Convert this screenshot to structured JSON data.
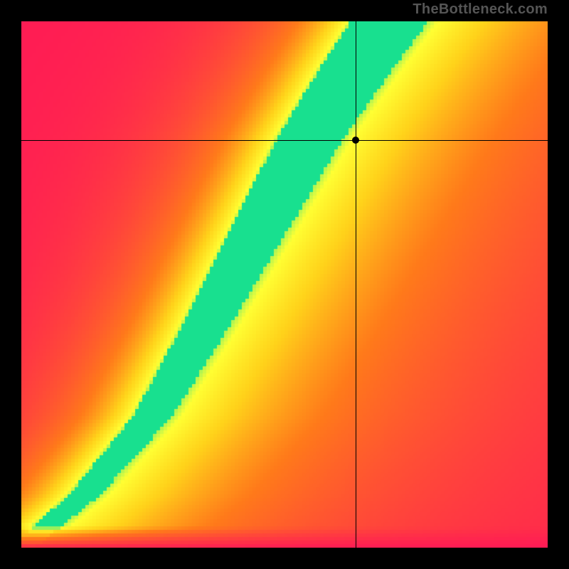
{
  "watermark": "TheBottleneck.com",
  "chart_data": {
    "type": "heatmap",
    "title": "",
    "xlabel": "",
    "ylabel": "",
    "xlim": [
      0,
      1
    ],
    "ylim": [
      0,
      1
    ],
    "crosshair": {
      "x": 0.635,
      "y": 0.775
    },
    "marker": {
      "x": 0.635,
      "y": 0.775
    },
    "colorscale": [
      {
        "stop": 0.0,
        "color": "#ff1a55"
      },
      {
        "stop": 0.45,
        "color": "#ff7a1a"
      },
      {
        "stop": 0.7,
        "color": "#ffd21a"
      },
      {
        "stop": 0.88,
        "color": "#ffff33"
      },
      {
        "stop": 1.0,
        "color": "#18e08f"
      }
    ],
    "ridge": {
      "description": "Narrow high-value S-curved ridge from bottom-left corner to top center, flanked by smooth falloff to low values on both sides.",
      "control_points_xy": [
        [
          0.0,
          0.0
        ],
        [
          0.12,
          0.1
        ],
        [
          0.25,
          0.25
        ],
        [
          0.35,
          0.42
        ],
        [
          0.45,
          0.6
        ],
        [
          0.55,
          0.78
        ],
        [
          0.63,
          0.9
        ],
        [
          0.7,
          1.0
        ]
      ],
      "ridge_half_width_x": 0.045
    }
  }
}
